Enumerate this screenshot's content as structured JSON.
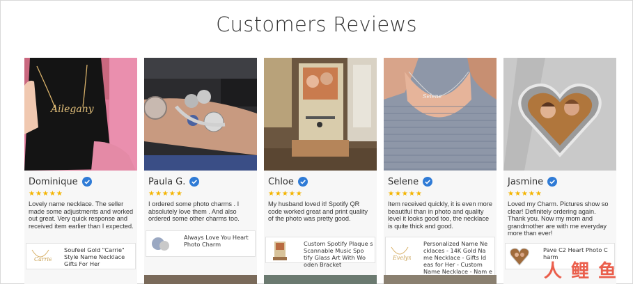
{
  "page": {
    "title": "Customers Reviews"
  },
  "reviews": [
    {
      "name": "Dominique",
      "stars": "★★★★★",
      "text": "Lovely name necklace. The seller made some adjustments and worked out great. Very quick response and received item earlier than I expected.",
      "product": "Soufeel Gold \"Carrie\" Style Name Necklace Gifts For Her"
    },
    {
      "name": "Paula G.",
      "stars": "★★★★★",
      "text": "I ordered some photo charms . I absolutely love them . And also ordered some other charms too.",
      "product": "Always Love You Heart Photo Charm"
    },
    {
      "name": "Chloe",
      "stars": "★★★★★",
      "text": "My husband loved it! Spotify QR code worked great and print quality of the photo was pretty good.",
      "product": "Custom Spotify Plaque s Scannable Music Spo tify Glass Art With Wo oden Bracket"
    },
    {
      "name": "Selene",
      "stars": "★★★★★",
      "text": "Item received quickly, it is even more beautiful than in photo and quality level it looks good too, the necklace is quite thick and good.",
      "product": "Personalized Name Ne cklaces - 14K Gold Na me Necklace - Gifts Id eas for Her - Custom Name Necklace - Nam e Plate Necklace"
    },
    {
      "name": "Jasmine",
      "stars": "★★★★★",
      "text": "Loved my Charm. Pictures show so clear! Definitely ordering again. Thank you. Now my mom and grandmother are with me everyday more than ever!",
      "product": "Pave C2 Heart Photo C harm"
    }
  ],
  "watermark": "人 鲤 鱼",
  "colors": {
    "star": "#f4b400",
    "verified": "#2f7bd6",
    "card_bg": "#f7f7f7"
  }
}
